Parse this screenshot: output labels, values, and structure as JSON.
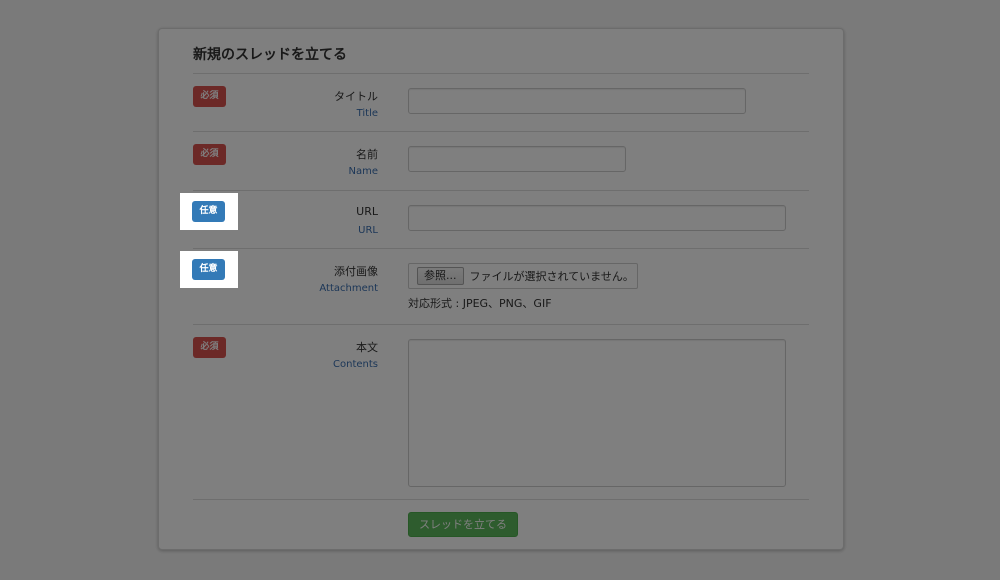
{
  "form": {
    "title": "新規のスレッドを立てる",
    "rows": {
      "title": {
        "badge": "必須",
        "label_ja": "タイトル",
        "label_en": "Title",
        "value": ""
      },
      "name": {
        "badge": "必須",
        "label_ja": "名前",
        "label_en": "Name",
        "value": ""
      },
      "url": {
        "badge": "任意",
        "label_ja": "URL",
        "label_en": "URL",
        "value": ""
      },
      "attachment": {
        "badge": "任意",
        "label_ja": "添付画像",
        "label_en": "Attachment",
        "browse_label": "参照...",
        "file_status": "ファイルが選択されていません。",
        "formats": "対応形式 : JPEG、PNG、GIF"
      },
      "contents": {
        "badge": "必須",
        "label_ja": "本文",
        "label_en": "Contents",
        "value": ""
      }
    },
    "submit_label": "スレッドを立てる"
  },
  "colors": {
    "required_badge": "#d9534f",
    "optional_badge": "#337ab7",
    "submit_button": "#5cb85c",
    "english_label": "#3a6fb0",
    "dim_overlay": "rgba(0,0,0,0.5)"
  }
}
